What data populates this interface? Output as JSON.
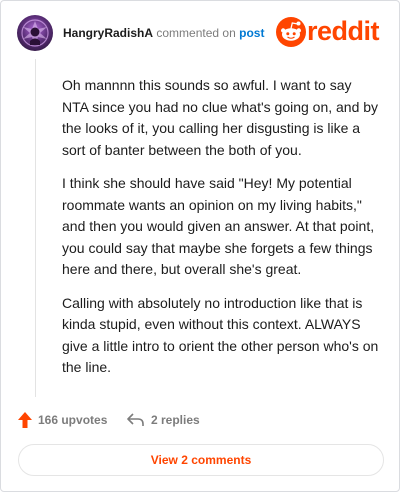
{
  "header": {
    "username": "HangryRadishA",
    "action_text": "commented on",
    "post_link": "post",
    "logo_text": "reddit",
    "logo_color": "#ff4500"
  },
  "comment": {
    "paragraphs": [
      "Oh mannnn this sounds so awful. I want to say NTA since you had no clue what's going on, and by the looks of it, you calling her disgusting is like a sort of banter between the both of you.",
      "I think she should have said \"Hey! My potential roommate wants an opinion on my living habits,\" and then you would given an answer. At that point, you could say that maybe she forgets a few things here and there, but overall she's great.",
      "Calling with absolutely no introduction like that is kinda stupid, even without this context. ALWAYS give a little intro to orient the other person who's on the line."
    ]
  },
  "actions": {
    "upvotes_label": "166 upvotes",
    "replies_label": "2 replies",
    "upvote_icon": "upvote-arrow-icon",
    "reply_icon": "reply-arrow-icon"
  },
  "footer": {
    "view_comments_label": "View 2 comments"
  },
  "colors": {
    "accent": "#ff4500",
    "link": "#0079d3",
    "muted": "#7c7c7c"
  }
}
